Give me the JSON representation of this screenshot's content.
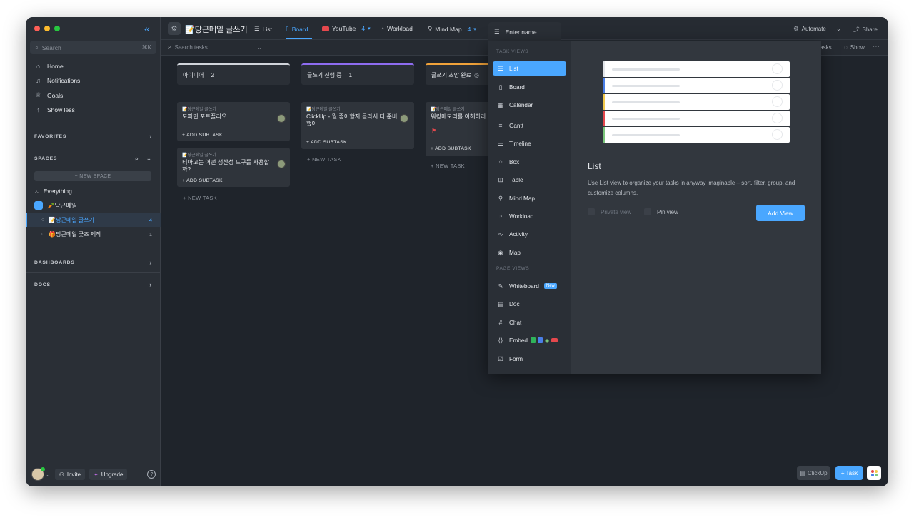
{
  "sidebar": {
    "search_placeholder": "Search",
    "search_shortcut": "⌘K",
    "nav": [
      {
        "label": "Home",
        "icon": "home-icon"
      },
      {
        "label": "Notifications",
        "icon": "bell-icon"
      },
      {
        "label": "Goals",
        "icon": "trophy-icon"
      },
      {
        "label": "Show less",
        "icon": "arrow-up-icon"
      }
    ],
    "favorites": "FAVORITES",
    "spaces": "SPACES",
    "new_space": "+ NEW SPACE",
    "everything": "Everything",
    "space_name": "🥕당근메일",
    "lists": [
      {
        "label": "📝당근메일 글쓰기",
        "count": "4"
      },
      {
        "label": "🎁당근메일 굿즈 제작",
        "count": "1"
      }
    ],
    "dashboards": "DASHBOARDS",
    "docs": "DOCS",
    "invite": "Invite",
    "upgrade": "Upgrade"
  },
  "topbar": {
    "title": "📝당근메일 글쓰기",
    "tabs": [
      {
        "label": "List"
      },
      {
        "label": "Board"
      },
      {
        "label": "YouTube",
        "count": "4"
      },
      {
        "label": "Workload"
      },
      {
        "label": "Mind Map",
        "count": "4"
      }
    ],
    "automate": "Automate",
    "share": "Share",
    "search_tasks": "Search tasks...",
    "subtasks": "tasks",
    "show": "Show"
  },
  "board": {
    "columns": [
      {
        "name": "아이디어",
        "count": "2",
        "color": "#d0d4da"
      },
      {
        "name": "글쓰기 진행 중",
        "count": "1",
        "color": "#8e6cf0"
      },
      {
        "name": "글쓰기 초안 완료",
        "count": "",
        "color": "#f0a23a"
      }
    ],
    "cards": [
      {
        "crumb": "📝당근메일 글쓰기",
        "title": "도파민 포트폴리오",
        "sub": "+ ADD SUBTASK"
      },
      {
        "crumb": "📝당근메일 글쓰기",
        "title": "티아고는 어떤 생산성 도구를 사용할까?",
        "sub": "+ ADD SUBTASK"
      },
      {
        "crumb": "📝당근메일 글쓰기",
        "title": "ClickUp - 뭘 좋아할지 몰라서 다 준비했어",
        "sub": "+ ADD SUBTASK"
      },
      {
        "crumb": "📝당근메일 글쓰기",
        "title": "워킹메모리를 이해하라",
        "sub": "+ ADD SUBTASK"
      }
    ],
    "new_task": "+ NEW TASK"
  },
  "view_menu": {
    "name_placeholder": "Enter name...",
    "task_views_label": "TASK VIEWS",
    "task_views": [
      {
        "label": "List",
        "icon": "list-icon"
      },
      {
        "label": "Board",
        "icon": "board-icon"
      },
      {
        "label": "Calendar",
        "icon": "calendar-icon"
      },
      {
        "label": "Gantt",
        "icon": "gantt-icon"
      },
      {
        "label": "Timeline",
        "icon": "timeline-icon"
      },
      {
        "label": "Box",
        "icon": "box-icon"
      },
      {
        "label": "Table",
        "icon": "table-icon"
      },
      {
        "label": "Mind Map",
        "icon": "mindmap-icon"
      },
      {
        "label": "Workload",
        "icon": "gauge-icon"
      },
      {
        "label": "Activity",
        "icon": "activity-icon"
      },
      {
        "label": "Map",
        "icon": "pin-icon"
      }
    ],
    "page_views_label": "PAGE VIEWS",
    "page_views": [
      {
        "label": "Whiteboard",
        "icon": "whiteboard-icon",
        "badge": "New"
      },
      {
        "label": "Doc",
        "icon": "doc-icon"
      },
      {
        "label": "Chat",
        "icon": "hash-icon"
      },
      {
        "label": "Embed",
        "icon": "code-icon"
      },
      {
        "label": "Form",
        "icon": "form-icon"
      }
    ],
    "preview": {
      "title": "List",
      "description": "Use List view to organize your tasks in anyway imaginable – sort, filter, group, and customize columns.",
      "private_view": "Private view",
      "pin_view": "Pin view",
      "add_view": "Add View"
    }
  },
  "footer": {
    "clickup": "ClickUp",
    "task": "+ Task"
  },
  "colors": {
    "accent": "#4aa7ff",
    "preview_rows": [
      "#e3e6ea",
      "#4a7fe8",
      "#f2c94c",
      "#e5484d",
      "#7bc67b"
    ]
  }
}
